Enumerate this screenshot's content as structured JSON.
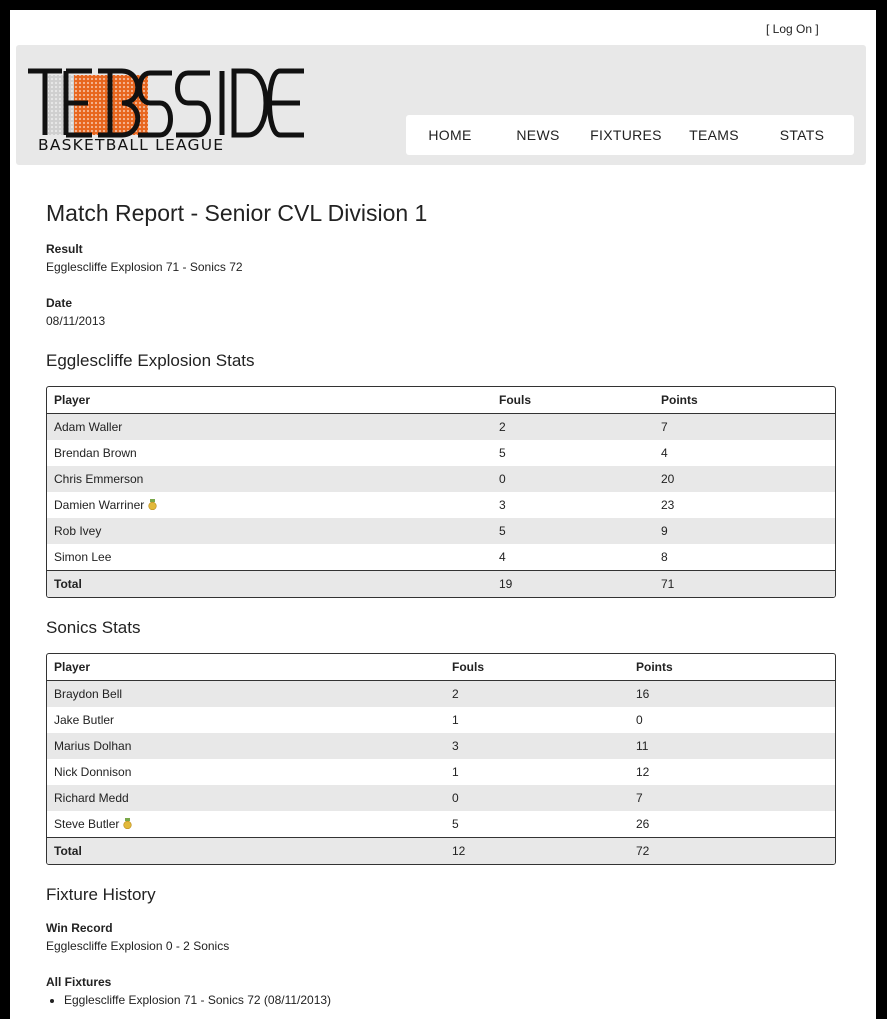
{
  "header": {
    "login": "[ Log On ]",
    "logo_text": "TEESSIDE",
    "logo_subtext": "BASKETBALL LEAGUE",
    "nav": [
      "HOME",
      "NEWS",
      "FIXTURES",
      "TEAMS",
      "STATS"
    ]
  },
  "report": {
    "title": "Match Report - Senior CVL Division 1",
    "result_label": "Result",
    "result_value": "Egglescliffe Explosion 71 - Sonics 72",
    "date_label": "Date",
    "date_value": "08/11/2013"
  },
  "home_stats": {
    "title": "Egglescliffe Explosion Stats",
    "columns": [
      "Player",
      "Fouls",
      "Points"
    ],
    "rows": [
      {
        "player": "Adam Waller",
        "fouls": "2",
        "points": "7",
        "medal": false
      },
      {
        "player": "Brendan Brown",
        "fouls": "5",
        "points": "4",
        "medal": false
      },
      {
        "player": "Chris Emmerson",
        "fouls": "0",
        "points": "20",
        "medal": false
      },
      {
        "player": "Damien Warriner",
        "fouls": "3",
        "points": "23",
        "medal": true
      },
      {
        "player": "Rob Ivey",
        "fouls": "5",
        "points": "9",
        "medal": false
      },
      {
        "player": "Simon Lee",
        "fouls": "4",
        "points": "8",
        "medal": false
      }
    ],
    "total": {
      "label": "Total",
      "fouls": "19",
      "points": "71"
    }
  },
  "away_stats": {
    "title": "Sonics Stats",
    "columns": [
      "Player",
      "Fouls",
      "Points"
    ],
    "rows": [
      {
        "player": "Braydon Bell",
        "fouls": "2",
        "points": "16",
        "medal": false
      },
      {
        "player": "Jake Butler",
        "fouls": "1",
        "points": "0",
        "medal": false
      },
      {
        "player": "Marius Dolhan",
        "fouls": "3",
        "points": "11",
        "medal": false
      },
      {
        "player": "Nick Donnison",
        "fouls": "1",
        "points": "12",
        "medal": false
      },
      {
        "player": "Richard Medd",
        "fouls": "0",
        "points": "7",
        "medal": false
      },
      {
        "player": "Steve Butler",
        "fouls": "5",
        "points": "26",
        "medal": true
      }
    ],
    "total": {
      "label": "Total",
      "fouls": "12",
      "points": "72"
    }
  },
  "history": {
    "title": "Fixture History",
    "win_label": "Win Record",
    "win_value": "Egglescliffe Explosion 0 - 2 Sonics",
    "fixtures_label": "All Fixtures",
    "fixtures": [
      "Egglescliffe Explosion 71 - Sonics 72 (08/11/2013)"
    ]
  },
  "colors": {
    "header_bg": "#e8e8e8",
    "row_alt": "#e8e8e8",
    "logo_orange": "#e8661e",
    "medal_gold": "#e2b93b"
  }
}
